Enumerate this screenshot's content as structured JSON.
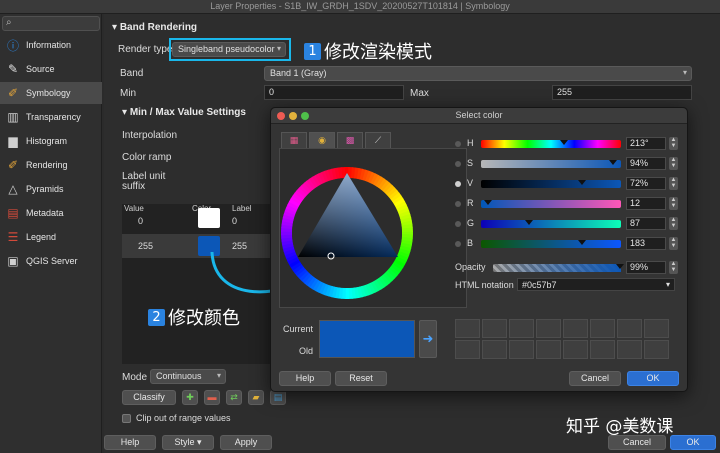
{
  "window": {
    "title": "Layer Properties - S1B_IW_GRDH_1SDV_20200527T101814 | Symbology"
  },
  "sidebar": {
    "search_icon": "search-icon",
    "items": [
      {
        "label": "Information",
        "icon": "info-icon",
        "color": "#2d86e0"
      },
      {
        "label": "Source",
        "icon": "wrench-icon",
        "color": "#e0e0e0"
      },
      {
        "label": "Symbology",
        "icon": "brush-icon",
        "color": "#e2a43a"
      },
      {
        "label": "Transparency",
        "icon": "transparency-icon",
        "color": "#cfcfcf"
      },
      {
        "label": "Histogram",
        "icon": "histogram-icon",
        "color": "#cfcfcf"
      },
      {
        "label": "Rendering",
        "icon": "rendering-brush-icon",
        "color": "#e2a43a"
      },
      {
        "label": "Pyramids",
        "icon": "pyramid-icon",
        "color": "#cfcfcf"
      },
      {
        "label": "Metadata",
        "icon": "metadata-icon",
        "color": "#d24a3a"
      },
      {
        "label": "Legend",
        "icon": "legend-icon",
        "color": "#d24a3a"
      },
      {
        "label": "QGIS Server",
        "icon": "server-icon",
        "color": "#cfcfcf"
      }
    ]
  },
  "band_rendering": {
    "header": "Band Rendering",
    "render_type_label": "Render type",
    "render_type_value": "Singleband pseudocolor",
    "band_label": "Band",
    "band_value": "Band 1 (Gray)",
    "min_label": "Min",
    "min_value": "0",
    "max_label": "Max",
    "max_value": "255",
    "minmax_header": "Min / Max Value Settings",
    "interpolation_label": "Interpolation",
    "color_ramp_label": "Color ramp",
    "label_unit_label": "Label unit",
    "suffix_label": "suffix",
    "table_headers": {
      "value": "Value",
      "color": "Color",
      "label": "Label"
    },
    "rows": [
      {
        "value": "0",
        "label": "0",
        "color": "#ffffff"
      },
      {
        "value": "255",
        "label": "255",
        "color": "#0c57b7"
      }
    ],
    "mode_label": "Mode",
    "mode_value": "Continuous",
    "classify_label": "Classify",
    "clip_label": "Clip out of range values"
  },
  "annotations": {
    "step1_num": "1",
    "step1_text": "修改渲染模式",
    "step2_num": "2",
    "step2_text": "修改颜色"
  },
  "bottom_bar": {
    "help": "Help",
    "style": "Style",
    "apply": "Apply",
    "cancel": "Cancel",
    "ok": "OK"
  },
  "watermark": "知乎 @美数课",
  "select_color": {
    "title": "Select color",
    "channels": [
      {
        "key": "H",
        "value": "213°",
        "pos": 0.59,
        "radio": false
      },
      {
        "key": "S",
        "value": "94%",
        "pos": 0.94,
        "radio": false
      },
      {
        "key": "V",
        "value": "72%",
        "pos": 0.72,
        "radio": true
      },
      {
        "key": "R",
        "value": "12",
        "pos": 0.05,
        "radio": false
      },
      {
        "key": "G",
        "value": "87",
        "pos": 0.34,
        "radio": false
      },
      {
        "key": "B",
        "value": "183",
        "pos": 0.72,
        "radio": false
      }
    ],
    "opacity_label": "Opacity",
    "opacity_value": "99%",
    "opacity_pos": 0.99,
    "html_label": "HTML notation",
    "html_value": "#0c57b7",
    "current_label": "Current",
    "old_label": "Old",
    "current_color": "#0c57b7",
    "help": "Help",
    "reset": "Reset",
    "cancel": "Cancel",
    "ok": "OK"
  }
}
